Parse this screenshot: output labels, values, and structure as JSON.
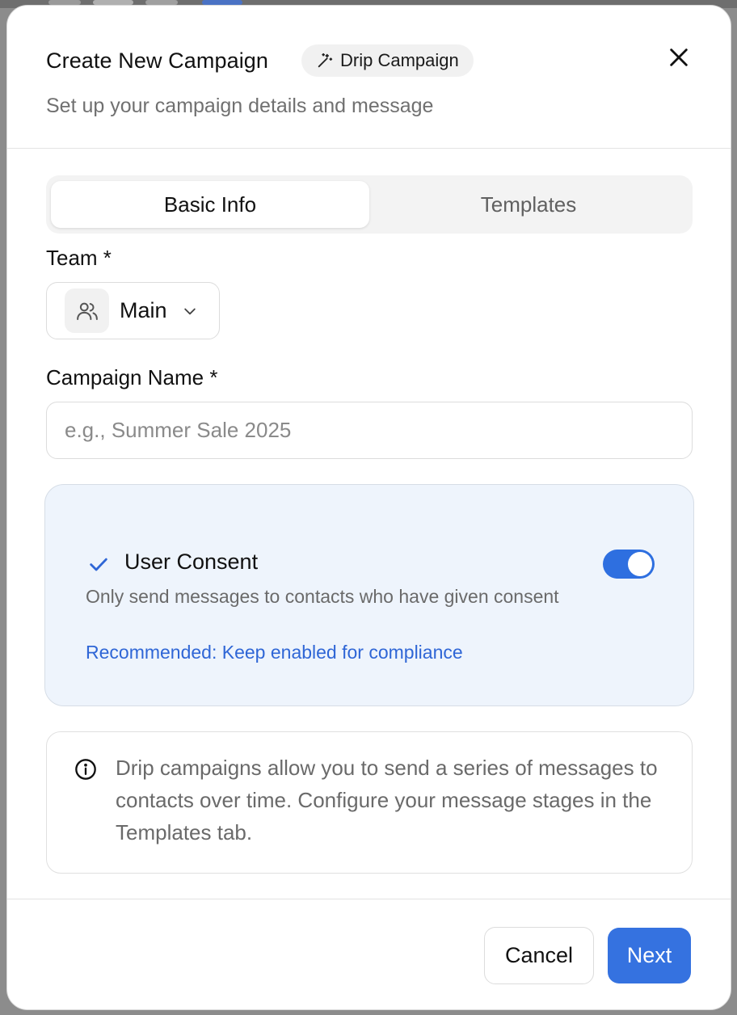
{
  "header": {
    "title": "Create New Campaign",
    "badge": "Drip Campaign",
    "subtitle": "Set up your campaign details and message"
  },
  "tabs": [
    {
      "label": "Basic Info",
      "active": true
    },
    {
      "label": "Templates",
      "active": false
    }
  ],
  "team": {
    "label": "Team *",
    "value": "Main",
    "icon": "users-icon"
  },
  "campaign_name": {
    "label": "Campaign Name *",
    "value": "",
    "placeholder": "e.g., Summer Sale 2025"
  },
  "consent": {
    "title": "User Consent",
    "description": "Only send messages to contacts who have given consent",
    "note": "Recommended: Keep enabled for compliance",
    "enabled": true
  },
  "info": {
    "text": "Drip campaigns allow you to send a series of messages to contacts over time. Configure your message stages in the Templates tab."
  },
  "footer": {
    "cancel_label": "Cancel",
    "next_label": "Next"
  },
  "colors": {
    "accent": "#3572e0",
    "toggle_on": "#2e6fe0",
    "consent_bg": "#eef4fc",
    "note_text": "#2f66d6"
  }
}
